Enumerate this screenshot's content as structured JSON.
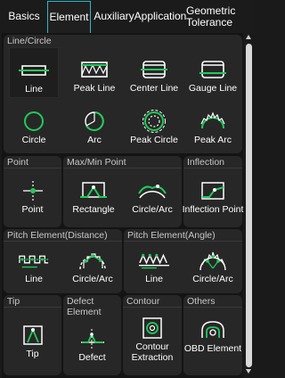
{
  "tabs": [
    {
      "label": "Basics"
    },
    {
      "label": "Element"
    },
    {
      "label": "Auxiliary"
    },
    {
      "label": "Application"
    },
    {
      "label": "Geometric Tolerance"
    }
  ],
  "active_tab": "Element",
  "accent_color": "#22c95a",
  "tab_highlight_color": "#2fb6c8",
  "groups": {
    "line_circle": {
      "title": "Line/Circle",
      "items": [
        "Line",
        "Peak Line",
        "Center Line",
        "Gauge Line",
        "Circle",
        "Arc",
        "Peak Circle",
        "Peak Arc"
      ]
    },
    "point": {
      "title": "Point",
      "items": [
        "Point"
      ]
    },
    "maxmin": {
      "title": "Max/Min Point",
      "items": [
        "Rectangle",
        "Circle/Arc"
      ]
    },
    "inflection": {
      "title": "Inflection",
      "items": [
        "Inflection Point"
      ]
    },
    "pitch_distance": {
      "title": "Pitch Element(Distance)",
      "items": [
        "Line",
        "Circle/Arc"
      ]
    },
    "pitch_angle": {
      "title": "Pitch Element(Angle)",
      "items": [
        "Line",
        "Circle/Arc"
      ]
    },
    "tip": {
      "title": "Tip",
      "items": [
        "Tip"
      ]
    },
    "defect": {
      "title": "Defect Element",
      "items": [
        "Defect"
      ]
    },
    "contour": {
      "title": "Contour",
      "items": [
        "Contour Extraction"
      ]
    },
    "others": {
      "title": "Others",
      "items": [
        "OBD Element"
      ]
    }
  }
}
